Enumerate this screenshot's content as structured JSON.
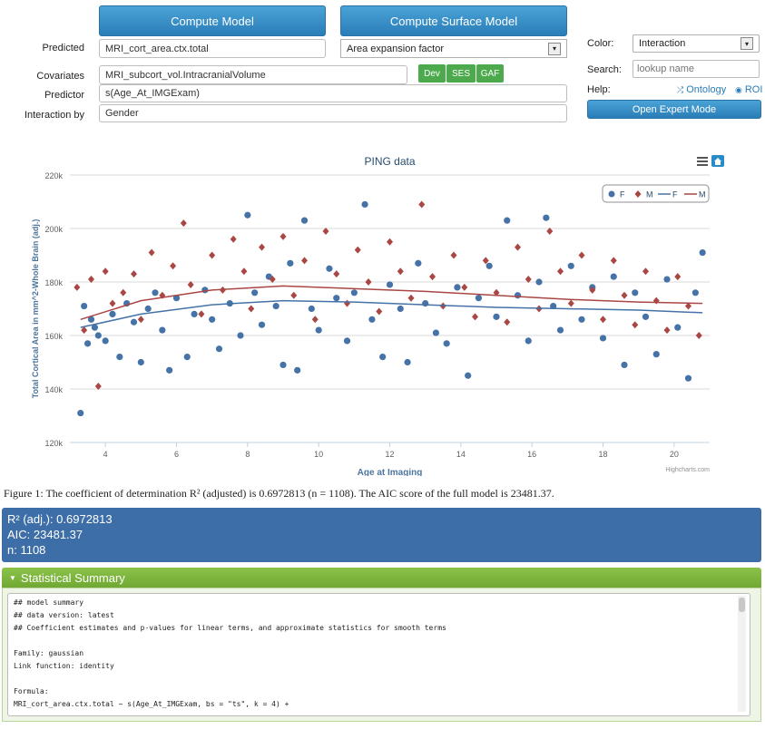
{
  "buttons": {
    "compute_model": "Compute Model",
    "compute_surface_model": "Compute Surface Model",
    "open_expert_mode": "Open Expert Mode"
  },
  "form": {
    "predicted_label": "Predicted",
    "predicted_value": "MRI_cort_area.ctx.total",
    "surface_select": "Area expansion factor",
    "covariates_label": "Covariates",
    "covariates_value": "MRI_subcort_vol.IntracranialVolume",
    "predictor_label": "Predictor",
    "predictor_value": "s(Age_At_IMGExam)",
    "interaction_label": "Interaction by",
    "interaction_value": "Gender",
    "tags": [
      "Dev",
      "SES",
      "GAF"
    ]
  },
  "side": {
    "color_label": "Color:",
    "color_value": "Interaction",
    "search_label": "Search:",
    "search_placeholder": "lookup name",
    "help_label": "Help:",
    "ontology_link": "Ontology",
    "roi_link": "ROI"
  },
  "chart_data": {
    "type": "scatter",
    "title": "PING data",
    "xlabel": "Age at Imaging",
    "ylabel": "Total Cortical Area in mm^2-Whole Brain (adj.)",
    "xlim": [
      3.0,
      21.0
    ],
    "ylim": [
      120000,
      220000
    ],
    "x_ticks": [
      4,
      6,
      8,
      10,
      12,
      14,
      16,
      18,
      20
    ],
    "y_ticks": [
      "120k",
      "140k",
      "160k",
      "180k",
      "200k",
      "220k"
    ],
    "grid": true,
    "legend_position": "top-right",
    "credit": "Highcharts.com",
    "colors": {
      "F": "#4572a7",
      "M": "#aa4643"
    },
    "series": [
      {
        "name": "F",
        "kind": "scatter",
        "marker": "circle",
        "points": [
          [
            3.3,
            131000
          ],
          [
            3.4,
            171000
          ],
          [
            3.5,
            157000
          ],
          [
            3.6,
            166000
          ],
          [
            3.7,
            163000
          ],
          [
            3.8,
            160000
          ],
          [
            4.0,
            158000
          ],
          [
            4.2,
            168000
          ],
          [
            4.4,
            152000
          ],
          [
            4.6,
            172000
          ],
          [
            4.8,
            165000
          ],
          [
            5.0,
            150000
          ],
          [
            5.2,
            170000
          ],
          [
            5.4,
            176000
          ],
          [
            5.6,
            162000
          ],
          [
            5.8,
            147000
          ],
          [
            6.0,
            174000
          ],
          [
            6.3,
            152000
          ],
          [
            6.5,
            168000
          ],
          [
            6.8,
            177000
          ],
          [
            7.0,
            166000
          ],
          [
            7.2,
            155000
          ],
          [
            7.5,
            172000
          ],
          [
            7.8,
            160000
          ],
          [
            8.0,
            205000
          ],
          [
            8.2,
            176000
          ],
          [
            8.4,
            164000
          ],
          [
            8.6,
            182000
          ],
          [
            8.8,
            171000
          ],
          [
            9.0,
            149000
          ],
          [
            9.2,
            187000
          ],
          [
            9.4,
            147000
          ],
          [
            9.6,
            203000
          ],
          [
            9.8,
            170000
          ],
          [
            10.0,
            162000
          ],
          [
            10.3,
            185000
          ],
          [
            10.5,
            174000
          ],
          [
            10.8,
            158000
          ],
          [
            11.0,
            176000
          ],
          [
            11.3,
            209000
          ],
          [
            11.5,
            166000
          ],
          [
            11.8,
            152000
          ],
          [
            12.0,
            179000
          ],
          [
            12.3,
            170000
          ],
          [
            12.5,
            150000
          ],
          [
            12.8,
            187000
          ],
          [
            13.0,
            172000
          ],
          [
            13.3,
            161000
          ],
          [
            13.6,
            157000
          ],
          [
            13.9,
            178000
          ],
          [
            14.2,
            145000
          ],
          [
            14.5,
            174000
          ],
          [
            14.8,
            186000
          ],
          [
            15.0,
            167000
          ],
          [
            15.3,
            203000
          ],
          [
            15.6,
            175000
          ],
          [
            15.9,
            158000
          ],
          [
            16.2,
            180000
          ],
          [
            16.4,
            204000
          ],
          [
            16.6,
            171000
          ],
          [
            16.8,
            162000
          ],
          [
            17.1,
            186000
          ],
          [
            17.4,
            166000
          ],
          [
            17.7,
            178000
          ],
          [
            18.0,
            159000
          ],
          [
            18.3,
            182000
          ],
          [
            18.6,
            149000
          ],
          [
            18.9,
            176000
          ],
          [
            19.2,
            167000
          ],
          [
            19.5,
            153000
          ],
          [
            19.8,
            181000
          ],
          [
            20.1,
            163000
          ],
          [
            20.4,
            144000
          ],
          [
            20.6,
            176000
          ],
          [
            20.8,
            191000
          ]
        ]
      },
      {
        "name": "M",
        "kind": "scatter",
        "marker": "diamond",
        "points": [
          [
            3.2,
            178000
          ],
          [
            3.4,
            162000
          ],
          [
            3.6,
            181000
          ],
          [
            3.8,
            141000
          ],
          [
            4.0,
            184000
          ],
          [
            4.2,
            172000
          ],
          [
            4.5,
            176000
          ],
          [
            4.8,
            183000
          ],
          [
            5.0,
            166000
          ],
          [
            5.3,
            191000
          ],
          [
            5.6,
            175000
          ],
          [
            5.9,
            186000
          ],
          [
            6.2,
            202000
          ],
          [
            6.4,
            179000
          ],
          [
            6.7,
            168000
          ],
          [
            7.0,
            190000
          ],
          [
            7.3,
            177000
          ],
          [
            7.6,
            196000
          ],
          [
            7.9,
            184000
          ],
          [
            8.1,
            170000
          ],
          [
            8.4,
            193000
          ],
          [
            8.7,
            181000
          ],
          [
            9.0,
            197000
          ],
          [
            9.3,
            175000
          ],
          [
            9.6,
            188000
          ],
          [
            9.9,
            166000
          ],
          [
            10.2,
            199000
          ],
          [
            10.5,
            183000
          ],
          [
            10.8,
            172000
          ],
          [
            11.1,
            192000
          ],
          [
            11.4,
            180000
          ],
          [
            11.7,
            169000
          ],
          [
            12.0,
            195000
          ],
          [
            12.3,
            184000
          ],
          [
            12.6,
            174000
          ],
          [
            12.9,
            209000
          ],
          [
            13.2,
            182000
          ],
          [
            13.5,
            171000
          ],
          [
            13.8,
            190000
          ],
          [
            14.1,
            178000
          ],
          [
            14.4,
            167000
          ],
          [
            14.7,
            188000
          ],
          [
            15.0,
            176000
          ],
          [
            15.3,
            165000
          ],
          [
            15.6,
            193000
          ],
          [
            15.9,
            181000
          ],
          [
            16.2,
            170000
          ],
          [
            16.5,
            199000
          ],
          [
            16.8,
            184000
          ],
          [
            17.1,
            172000
          ],
          [
            17.4,
            190000
          ],
          [
            17.7,
            177000
          ],
          [
            18.0,
            166000
          ],
          [
            18.3,
            188000
          ],
          [
            18.6,
            175000
          ],
          [
            18.9,
            164000
          ],
          [
            19.2,
            184000
          ],
          [
            19.5,
            173000
          ],
          [
            19.8,
            162000
          ],
          [
            20.1,
            182000
          ],
          [
            20.4,
            171000
          ],
          [
            20.7,
            160000
          ]
        ]
      },
      {
        "name": "F",
        "kind": "line",
        "points": [
          [
            3.3,
            163000
          ],
          [
            5,
            168000
          ],
          [
            7,
            171500
          ],
          [
            9,
            173000
          ],
          [
            11,
            172500
          ],
          [
            13,
            171500
          ],
          [
            15,
            170500
          ],
          [
            17,
            170000
          ],
          [
            19,
            169500
          ],
          [
            20.8,
            168500
          ]
        ]
      },
      {
        "name": "M",
        "kind": "line",
        "points": [
          [
            3.3,
            166000
          ],
          [
            5,
            173000
          ],
          [
            7,
            177000
          ],
          [
            9,
            178500
          ],
          [
            11,
            177500
          ],
          [
            13,
            176500
          ],
          [
            15,
            175000
          ],
          [
            17,
            173500
          ],
          [
            19,
            172500
          ],
          [
            20.8,
            172000
          ]
        ]
      }
    ]
  },
  "caption": "Figure 1: The coefficient of determination R² (adjusted) is 0.6972813 (n = 1108). The AIC score of the full model is 23481.37.",
  "stats": {
    "r2": "R² (adj.): 0.6972813",
    "aic": "AIC: 23481.37",
    "n": "n: 1108"
  },
  "summary": {
    "title": "Statistical Summary",
    "lines": [
      "## model summary",
      "## data version: latest",
      "## Coefficient estimates and p-values for linear terms, and approximate statistics for smooth terms",
      "",
      "Family: gaussian",
      "Link function: identity",
      "",
      "Formula:",
      "MRI_cort_area.ctx.total ~ s(Age_At_IMGExam, bs = \"ts\", k = 4) +"
    ]
  }
}
